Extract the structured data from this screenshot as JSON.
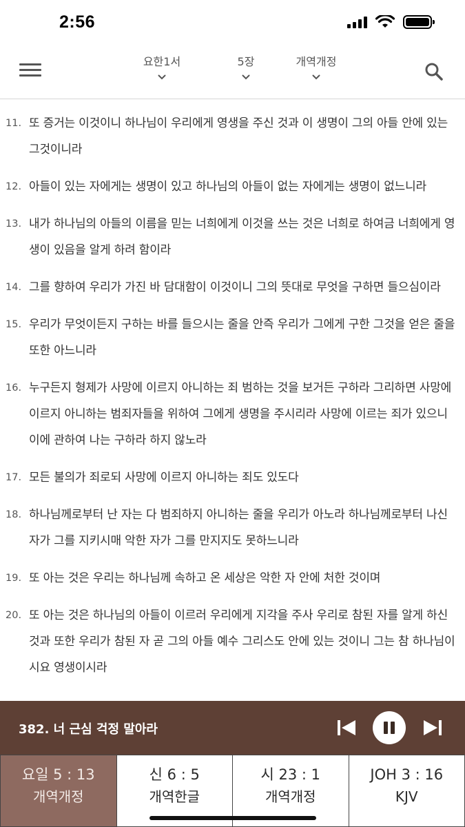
{
  "status_bar": {
    "time": "2:56"
  },
  "header": {
    "book": "요한1서",
    "chapter": "5장",
    "version": "개역개정",
    "menu_icon": "hamburger-menu-icon",
    "search_icon": "search-icon"
  },
  "verses": [
    {
      "num": "11.",
      "text": "또 증거는 이것이니 하나님이 우리에게 영생을 주신 것과 이 생명이 그의 아들 안에 있는 그것이니라"
    },
    {
      "num": "12.",
      "text": "아들이 있는 자에게는 생명이 있고 하나님의 아들이 없는 자에게는 생명이 없느니라"
    },
    {
      "num": "13.",
      "text": "내가 하나님의 아들의 이름을 믿는 너희에게 이것을 쓰는 것은 너희로 하여금 너희에게 영생이 있음을 알게 하려 함이라"
    },
    {
      "num": "14.",
      "text": "그를 향하여 우리가 가진 바 담대함이 이것이니 그의 뜻대로 무엇을 구하면 들으심이라"
    },
    {
      "num": "15.",
      "text": "우리가 무엇이든지 구하는 바를 들으시는 줄을 안즉 우리가 그에게 구한 그것을 얻은 줄을 또한 아느니라"
    },
    {
      "num": "16.",
      "text": "누구든지 형제가 사망에 이르지 아니하는 죄 범하는 것을 보거든 구하라 그리하면 사망에 이르지 아니하는 범죄자들을 위하여 그에게 생명을 주시리라 사망에 이르는 죄가 있으니 이에 관하여 나는 구하라 하지 않노라"
    },
    {
      "num": "17.",
      "text": "모든 불의가 죄로되 사망에 이르지 아니하는 죄도 있도다"
    },
    {
      "num": "18.",
      "text": "하나님께로부터 난 자는 다 범죄하지 아니하는 줄을 우리가 아노라 하나님께로부터 나신 자가 그를 지키시매 악한 자가 그를 만지지도 못하느니라"
    },
    {
      "num": "19.",
      "text": "또 아는 것은 우리는 하나님께 속하고 온 세상은 악한 자 안에 처한 것이며"
    },
    {
      "num": "20.",
      "text": "또 아는 것은 하나님의 아들이 이르러 우리에게 지각을 주사 우리로 참된 자를 알게 하신 것과 또한 우리가 참된 자 곧 그의 아들 예수 그리스도 안에 있는 것이니 그는 참 하나님이시요 영생이시라"
    }
  ],
  "player": {
    "title": "382. 너 근심 걱정 말아라",
    "prev_icon": "skip-previous-icon",
    "pause_icon": "pause-icon",
    "next_icon": "skip-next-icon",
    "background": "#5e4035"
  },
  "tabs": [
    {
      "ref": "요일 5 : 13",
      "version": "개역개정",
      "active": true
    },
    {
      "ref": "신 6 : 5",
      "version": "개역한글",
      "active": false
    },
    {
      "ref": "시 23 : 1",
      "version": "개역개정",
      "active": false
    },
    {
      "ref": "JOH 3 : 16",
      "version": "KJV",
      "active": false
    }
  ],
  "colors": {
    "active_tab": "#8e6a60",
    "player_bg": "#5e4035"
  }
}
